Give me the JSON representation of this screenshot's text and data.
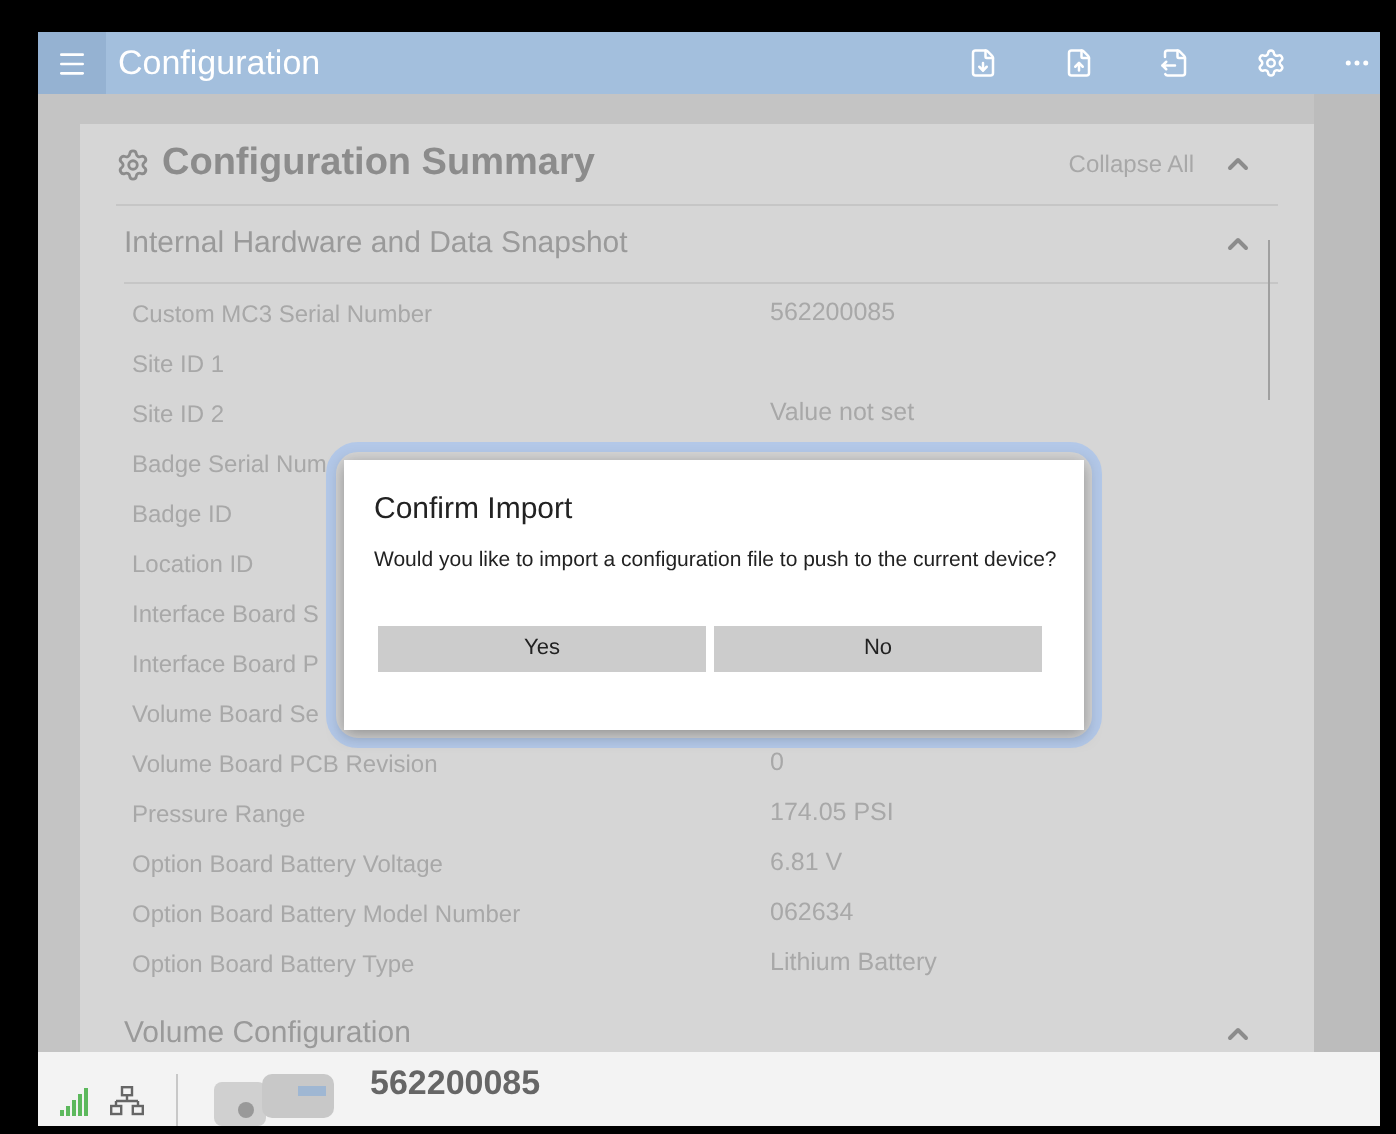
{
  "header": {
    "title": "Configuration"
  },
  "summary": {
    "title": "Configuration Summary",
    "collapse_all": "Collapse All",
    "expanded": true
  },
  "sections": [
    {
      "title": "Internal Hardware and Data Snapshot",
      "expanded": true,
      "rows": [
        {
          "label": "Custom MC3 Serial Number",
          "value": "562200085"
        },
        {
          "label": "Site ID 1"
        },
        {
          "label": "Site ID 2",
          "value": "Value not set"
        },
        {
          "label": "Badge Serial Num"
        },
        {
          "label": "Badge ID"
        },
        {
          "label": "Location ID"
        },
        {
          "label": "Interface Board S"
        },
        {
          "label": "Interface Board P"
        },
        {
          "label": "Volume Board Se"
        },
        {
          "label": "Volume Board PCB Revision",
          "value": "0"
        },
        {
          "label": "Pressure Range",
          "value": "174.05 PSI"
        },
        {
          "label": "Option Board Battery Voltage",
          "value": "6.81 V"
        },
        {
          "label": "Option Board Battery Model Number",
          "value": "062634"
        },
        {
          "label": "Option Board Battery Type",
          "value": "Lithium Battery"
        }
      ]
    },
    {
      "title": "Volume Configuration",
      "expanded": true
    }
  ],
  "dialog": {
    "title": "Confirm Import",
    "message": "Would you like to import a configuration file to push to the current device?",
    "buttons": [
      "Yes",
      "No"
    ]
  },
  "status_bar": {
    "device_serial": "562200085"
  }
}
